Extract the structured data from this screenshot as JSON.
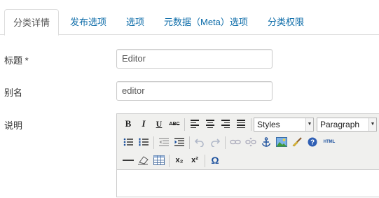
{
  "tabs": [
    {
      "label": "分类详情",
      "active": true
    },
    {
      "label": "发布选项"
    },
    {
      "label": "选项"
    },
    {
      "label": "元数据（Meta）选项"
    },
    {
      "label": "分类权限"
    }
  ],
  "form": {
    "title_label": "标题 *",
    "title_value": "Editor",
    "alias_label": "别名",
    "alias_value": "editor",
    "description_label": "说明"
  },
  "editor": {
    "styles_select": "Styles",
    "format_select": "Paragraph",
    "icons": {
      "bold": "B",
      "italic": "I",
      "underline": "U",
      "strike": "ABC",
      "subscript": "x₂",
      "superscript": "x²",
      "omega": "Ω",
      "html": "HTML"
    }
  },
  "colors": {
    "link": "#0b6ba8",
    "border": "#dddddd",
    "toolbar_bg": "#f0f0ee"
  }
}
